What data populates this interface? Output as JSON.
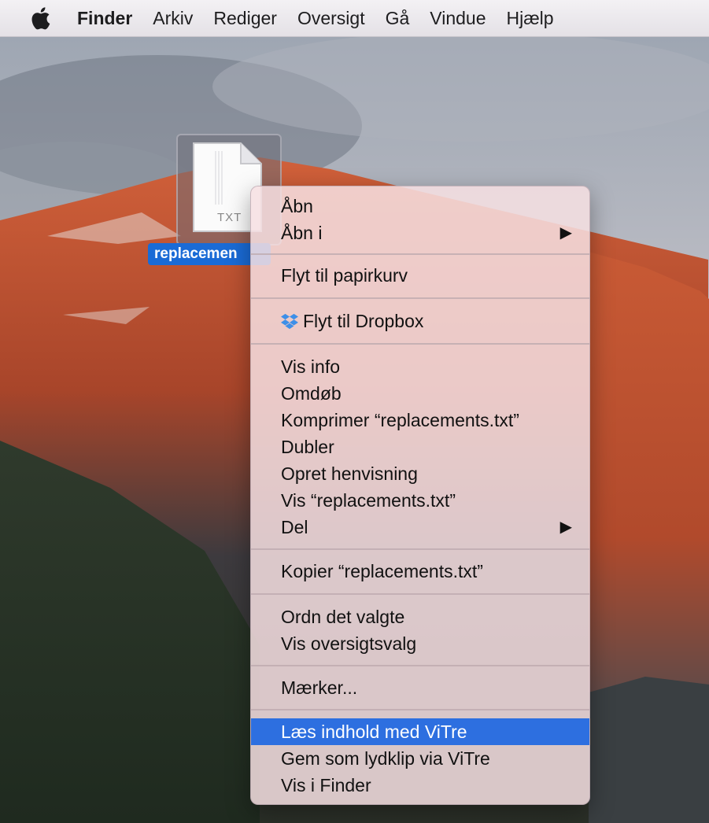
{
  "menubar": {
    "apple_icon": "apple-logo-icon",
    "app_name": "Finder",
    "items": [
      "Arkiv",
      "Rediger",
      "Oversigt",
      "Gå",
      "Vindue",
      "Hjælp"
    ]
  },
  "desktop": {
    "file": {
      "name": "replacemen",
      "type_label": "TXT",
      "icon": "text-document-icon"
    }
  },
  "context_menu": {
    "open": "Åbn",
    "open_with": "Åbn i",
    "trash": "Flyt til papirkurv",
    "dropbox": "Flyt til Dropbox",
    "dropbox_icon": "dropbox-icon",
    "info": "Vis info",
    "rename": "Omdøb",
    "compress": "Komprimer “replacements.txt”",
    "duplicate": "Dubler",
    "alias": "Opret henvisning",
    "quicklook": "Vis “replacements.txt”",
    "share": "Del",
    "copy": "Kopier “replacements.txt”",
    "arrange": "Ordn det valgte",
    "view_options": "Vis oversigtsvalg",
    "tags": "Mærker...",
    "read_vitre": "Læs indhold med ViTre",
    "save_vitre": "Gem som lydklip via ViTre",
    "show_finder": "Vis i Finder",
    "highlighted": "read_vitre",
    "highlight_color": "#2d6fe0",
    "submenu_arrow": "right-triangle-icon"
  }
}
